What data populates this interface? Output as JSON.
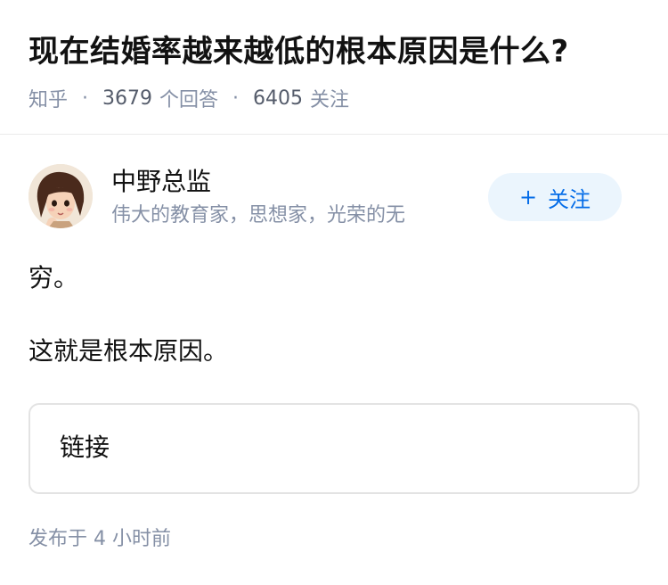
{
  "question": {
    "title": "现在结婚率越来越低的根本原因是什么?",
    "source": "知乎",
    "answer_count": "3679",
    "answer_label": "个回答",
    "follower_count": "6405",
    "follower_label": "关注",
    "separator": "·"
  },
  "author": {
    "name": "中野总监",
    "bio": "伟大的教育家，思想家，光荣的无",
    "follow_plus": "+",
    "follow_label": "关注",
    "avatar_icon": "cartoon-girl-avatar"
  },
  "answer": {
    "paragraphs": [
      "穷。",
      "这就是根本原因。"
    ],
    "link_card_label": "链接",
    "published": "发布于 4 小时前"
  },
  "colors": {
    "accent": "#056de8",
    "follow_bg": "#ebf5fd",
    "meta_gray": "#8590a6",
    "text": "#121212"
  }
}
